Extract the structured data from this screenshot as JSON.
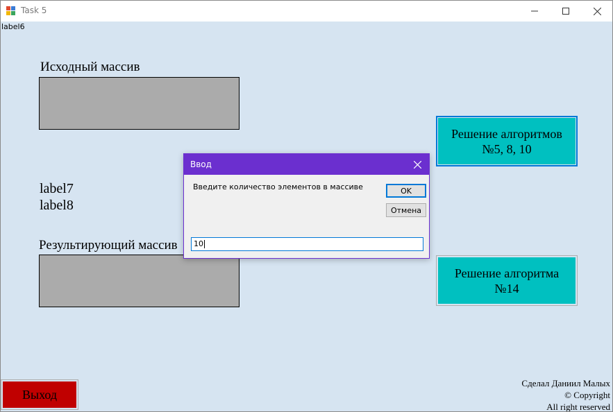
{
  "window": {
    "title": "Task 5"
  },
  "form": {
    "label6": "label6",
    "source_caption": "Исходный массив",
    "label7": "label7",
    "label8": "label8",
    "result_caption": "Результирующий массив",
    "algo_btn_1": "Решение алгоритмов\n№5, 8, 10",
    "algo_btn_2": "Решение алгоритма\n№14",
    "exit_label": "Выход",
    "copyright": [
      "Сделал Даниил Малых",
      "© Copyright",
      "All right reserved"
    ]
  },
  "dialog": {
    "title": "Ввод",
    "prompt": "Введите количество элементов в массиве",
    "ok_label": "OK",
    "cancel_label": "Отмена",
    "input_value": "10"
  },
  "colors": {
    "form_bg": "#d6e4f1",
    "teal": "#00c0c0",
    "exit_red": "#c00000",
    "dialog_accent": "#6b2fcf",
    "array_box": "#ababab"
  },
  "icons": [
    "app-icon",
    "minimize-icon",
    "maximize-icon",
    "close-icon",
    "dialog-close-icon"
  ]
}
